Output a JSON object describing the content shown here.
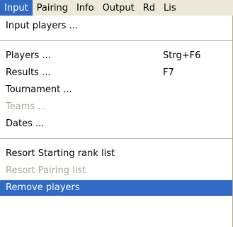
{
  "menubar": {
    "items": [
      "Input",
      "Pairing",
      "Info",
      "Output",
      "Rd",
      "Lis"
    ],
    "active_index": 0
  },
  "menu": {
    "items": [
      {
        "label": "Input players ...",
        "shortcut": "",
        "disabled": false
      },
      {
        "label": "Players ...",
        "shortcut": "Strg+F6",
        "disabled": false
      },
      {
        "label": "Results ...",
        "shortcut": "F7",
        "disabled": false
      },
      {
        "label": "Tournament ...",
        "shortcut": "",
        "disabled": false
      },
      {
        "label": "Teams ...",
        "shortcut": "",
        "disabled": true
      },
      {
        "label": "Dates ...",
        "shortcut": "",
        "disabled": false
      },
      {
        "label": "Resort Starting rank list",
        "shortcut": "",
        "disabled": false
      },
      {
        "label": "Resort Pairing list",
        "shortcut": "",
        "disabled": true
      },
      {
        "label": "Remove players",
        "shortcut": "",
        "disabled": false,
        "highlighted": true
      }
    ]
  },
  "colors": {
    "highlight": "#316ac5",
    "menubar_bg": "#ece9d8",
    "disabled_text": "#aca899"
  }
}
